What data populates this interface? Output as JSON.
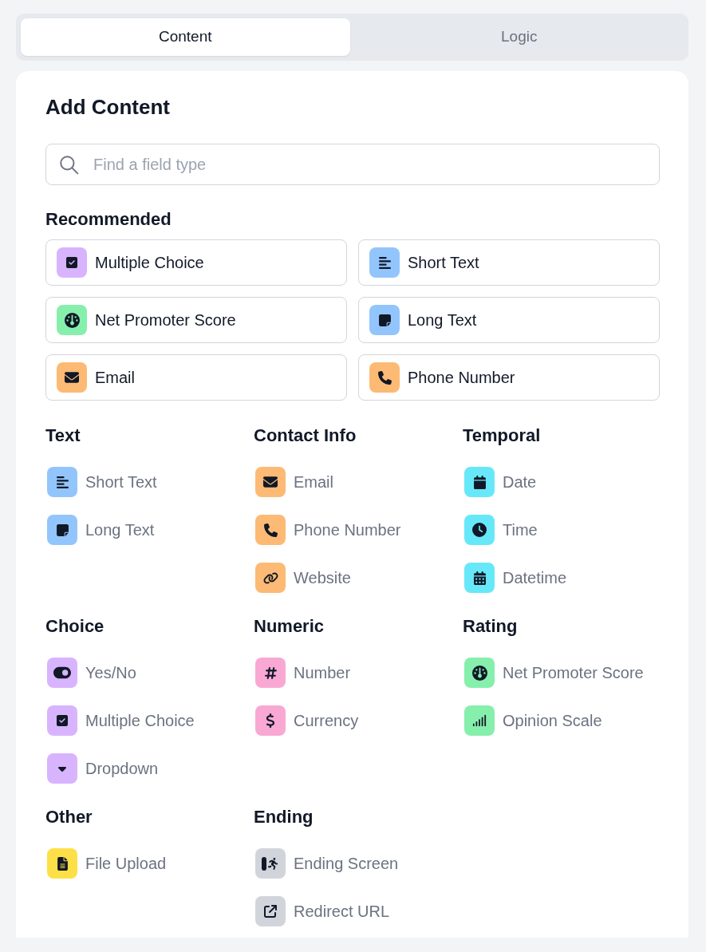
{
  "tabs": [
    {
      "label": "Content",
      "selected": true
    },
    {
      "label": "Logic",
      "selected": false
    }
  ],
  "title": "Add Content",
  "search": {
    "placeholder": "Find a field type"
  },
  "recommended": {
    "heading": "Recommended",
    "items": [
      {
        "label": "Multiple Choice",
        "kind": "checkbox",
        "color": "#d8b4fe"
      },
      {
        "label": "Short Text",
        "kind": "lines",
        "color": "#93c5fd"
      },
      {
        "label": "Net Promoter Score",
        "kind": "gauge",
        "color": "#86efac"
      },
      {
        "label": "Long Text",
        "kind": "note",
        "color": "#93c5fd"
      },
      {
        "label": "Email",
        "kind": "mail",
        "color": "#fdba74"
      },
      {
        "label": "Phone Number",
        "kind": "phone",
        "color": "#fdba74"
      }
    ]
  },
  "sections": [
    {
      "heading": "Text",
      "items": [
        {
          "label": "Short Text",
          "kind": "lines",
          "color": "#93c5fd"
        },
        {
          "label": "Long Text",
          "kind": "note",
          "color": "#93c5fd"
        }
      ]
    },
    {
      "heading": "Contact Info",
      "items": [
        {
          "label": "Email",
          "kind": "mail",
          "color": "#fdba74"
        },
        {
          "label": "Phone Number",
          "kind": "phone",
          "color": "#fdba74"
        },
        {
          "label": "Website",
          "kind": "link",
          "color": "#fdba74"
        }
      ]
    },
    {
      "heading": "Temporal",
      "items": [
        {
          "label": "Date",
          "kind": "calendar",
          "color": "#67e8f9"
        },
        {
          "label": "Time",
          "kind": "clock",
          "color": "#67e8f9"
        },
        {
          "label": "Datetime",
          "kind": "calendargrid",
          "color": "#67e8f9"
        }
      ]
    },
    {
      "heading": "Choice",
      "items": [
        {
          "label": "Yes/No",
          "kind": "toggle",
          "color": "#d8b4fe"
        },
        {
          "label": "Multiple Choice",
          "kind": "checkbox",
          "color": "#d8b4fe"
        },
        {
          "label": "Dropdown",
          "kind": "caret",
          "color": "#d8b4fe"
        }
      ]
    },
    {
      "heading": "Numeric",
      "items": [
        {
          "label": "Number",
          "kind": "hash",
          "color": "#f9a8d4"
        },
        {
          "label": "Currency",
          "kind": "dollar",
          "color": "#f9a8d4"
        }
      ]
    },
    {
      "heading": "Rating",
      "items": [
        {
          "label": "Net Promoter Score",
          "kind": "gauge",
          "color": "#86efac"
        },
        {
          "label": "Opinion Scale",
          "kind": "bars",
          "color": "#86efac"
        }
      ]
    },
    {
      "heading": "Other",
      "items": [
        {
          "label": "File Upload",
          "kind": "file",
          "color": "#fde047"
        }
      ]
    },
    {
      "heading": "Ending",
      "items": [
        {
          "label": "Ending Screen",
          "kind": "exit",
          "color": "#d1d5db"
        },
        {
          "label": "Redirect URL",
          "kind": "redirect",
          "color": "#d1d5db"
        }
      ]
    }
  ]
}
